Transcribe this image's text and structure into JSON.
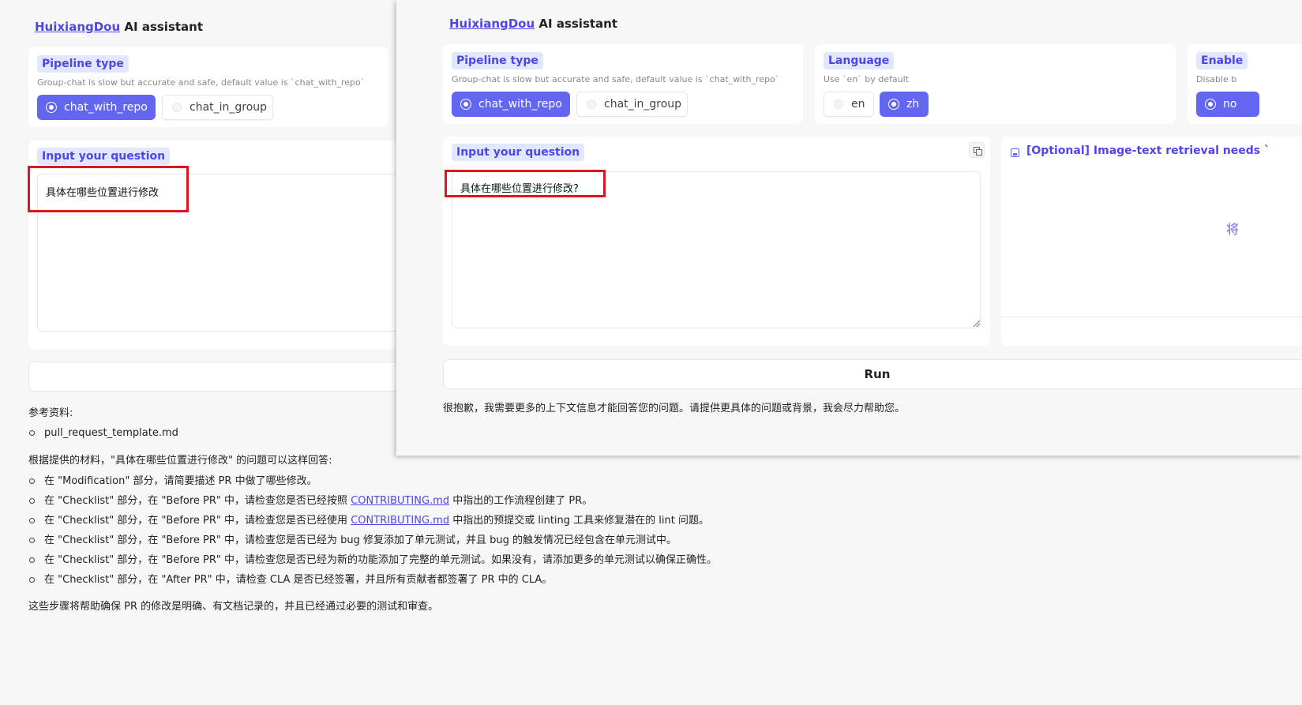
{
  "back": {
    "header": {
      "link": "HuixiangDou",
      "rest": "AI assistant"
    },
    "pipeline": {
      "label": "Pipeline type",
      "info": "Group-chat is slow but accurate and safe, default value is `chat_with_repo`",
      "options": [
        "chat_with_repo",
        "chat_in_group"
      ]
    },
    "question": {
      "label": "Input your question",
      "value": "具体在哪些位置进行修改"
    },
    "output": {
      "refs_title": "参考资料:",
      "refs": [
        "pull_request_template.md"
      ],
      "intro": "根据提供的材料，\"具体在哪些位置进行修改\" 的问题可以这样回答:",
      "items": [
        {
          "pre": "在 \"Modification\" 部分，请简要描述 PR 中做了哪些修改。",
          "link": "",
          "post": ""
        },
        {
          "pre": "在 \"Checklist\" 部分，在 \"Before PR\" 中，请检查您是否已经按照 ",
          "link": "CONTRIBUTING.md",
          "post": " 中指出的工作流程创建了 PR。"
        },
        {
          "pre": "在 \"Checklist\" 部分，在 \"Before PR\" 中，请检查您是否已经使用 ",
          "link": "CONTRIBUTING.md",
          "post": " 中指出的预提交或 linting 工具来修复潜在的 lint 问题。"
        },
        {
          "pre": "在 \"Checklist\" 部分，在 \"Before PR\" 中，请检查您是否已经为 bug 修复添加了单元测试，并且 bug 的触发情况已经包含在单元测试中。",
          "link": "",
          "post": ""
        },
        {
          "pre": "在 \"Checklist\" 部分，在 \"Before PR\" 中，请检查您是否已经为新的功能添加了完整的单元测试。如果没有，请添加更多的单元测试以确保正确性。",
          "link": "",
          "post": ""
        },
        {
          "pre": "在 \"Checklist\" 部分，在 \"After PR\" 中，请检查 CLA 是否已经签署，并且所有贡献者都签署了 PR 中的 CLA。",
          "link": "",
          "post": ""
        }
      ],
      "conclusion": "这些步骤将帮助确保 PR 的修改是明确、有文档记录的，并且已经通过必要的测试和审查。"
    }
  },
  "front": {
    "header": {
      "link": "HuixiangDou",
      "rest": "AI assistant"
    },
    "pipeline": {
      "label": "Pipeline type",
      "info": "Group-chat is slow but accurate and safe, default value is `chat_with_repo`",
      "options": [
        "chat_with_repo",
        "chat_in_group"
      ]
    },
    "language": {
      "label": "Language",
      "info": "Use `en` by default",
      "options": [
        "en",
        "zh"
      ]
    },
    "enable": {
      "label": "Enable",
      "info": "Disable b",
      "option": "no"
    },
    "question": {
      "label": "Input your question",
      "value": "具体在哪些位置进行修改?"
    },
    "image": {
      "label": "[Optional] Image-text retrieval needs `",
      "placeholder_char": "将"
    },
    "run_label": "Run",
    "answer": "很抱歉，我需要更多的上下文信息才能回答您的问题。请提供更具体的问题或背景，我会尽力帮助您。"
  },
  "colors": {
    "accent": "#6366f1",
    "chip_bg": "#e0e7ff",
    "highlight": "#e0141e"
  }
}
